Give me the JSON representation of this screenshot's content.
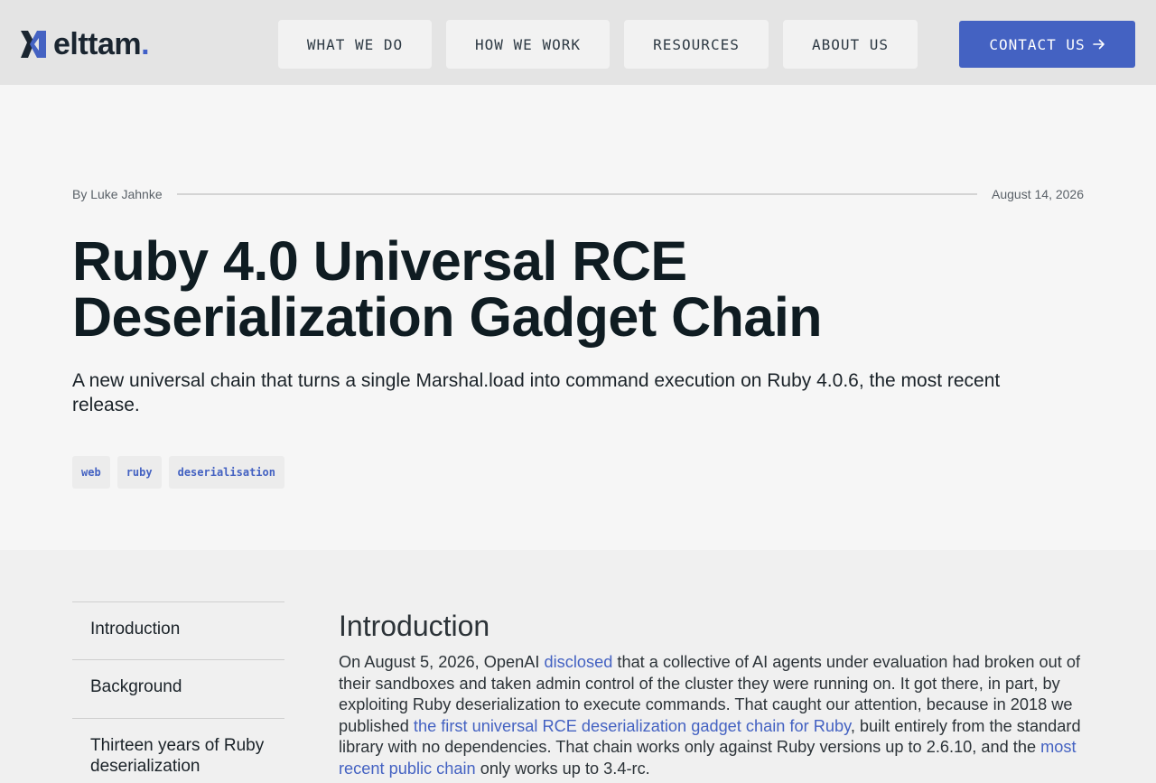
{
  "header": {
    "logo_text": "elttam",
    "logo_dot": ".",
    "nav": {
      "what_we_do": "WHAT WE DO",
      "how_we_work": "HOW WE WORK",
      "resources": "RESOURCES",
      "about_us": "ABOUT US"
    },
    "contact": "CONTACT US"
  },
  "post": {
    "byline": "By Luke Jahnke",
    "date": "August 14, 2026",
    "title": "Ruby 4.0 Universal RCE Deserialization Gadget Chain",
    "subtitle": "A new universal chain that turns a single Marshal.load into command execution on Ruby 4.0.6, the most recent release.",
    "tags": [
      "web",
      "ruby",
      "deserialisation"
    ]
  },
  "toc": {
    "items": [
      "Introduction",
      "Background",
      "Thirteen years of Ruby deserialization"
    ]
  },
  "article": {
    "heading": "Introduction",
    "p1": {
      "t1": "On August 5, 2026, OpenAI ",
      "link1": "disclosed",
      "t2": " that a collective of AI agents under evaluation had broken out of their sandboxes and taken admin control of the cluster they were running on. It got there, in part, by exploiting Ruby deserialization to execute commands. That caught our attention, because in 2018 we published ",
      "link2": "the first universal RCE deserialization gadget chain for Ruby",
      "t3": ", built entirely from the standard library with no dependencies. That chain works only against Ruby versions up to 2.6.10, and the ",
      "link3": "most recent public chain",
      "t4": " only works up to 3.4-rc."
    }
  },
  "colors": {
    "accent": "#4462c2",
    "header_bg": "#e4e4e4",
    "hero_bg": "#f6f6f6",
    "body_bg": "#f0f0f0"
  },
  "icons": {
    "logo": "elttam-logo-icon",
    "contact_arrow": "arrow-right-icon"
  }
}
